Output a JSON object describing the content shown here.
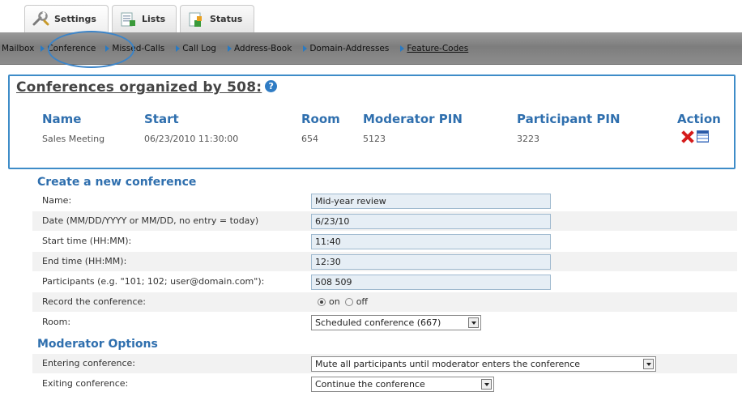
{
  "tabs": [
    {
      "label": "Settings",
      "icon": "wrench-icon"
    },
    {
      "label": "Lists",
      "icon": "list-icon"
    },
    {
      "label": "Status",
      "icon": "status-icon"
    }
  ],
  "subnav": [
    {
      "label": "Mailbox"
    },
    {
      "label": "Conference"
    },
    {
      "label": "Missed-Calls"
    },
    {
      "label": "Call Log"
    },
    {
      "label": "Address-Book"
    },
    {
      "label": "Domain-Addresses"
    },
    {
      "label": "Feature-Codes"
    }
  ],
  "conferences": {
    "title": "Conferences organized by 508:",
    "help_icon": "?",
    "headers": {
      "name": "Name",
      "start": "Start",
      "room": "Room",
      "moderator_pin": "Moderator PIN",
      "participant_pin": "Participant PIN",
      "action": "Action"
    },
    "rows": [
      {
        "name": "Sales Meeting",
        "start": "06/23/2010 11:30:00",
        "room": "654",
        "moderator_pin": "5123",
        "participant_pin": "3223"
      }
    ]
  },
  "create": {
    "heading": "Create a new conference",
    "name_label": "Name:",
    "name_value": "Mid-year review",
    "date_label": "Date (MM/DD/YYYY or MM/DD, no entry = today)",
    "date_value": "6/23/10",
    "start_label": "Start time (HH:MM):",
    "start_value": "11:40",
    "end_label": "End time (HH:MM):",
    "end_value": "12:30",
    "participants_label": "Participants (e.g. \"101; 102; user@domain.com\"):",
    "participants_value": "508 509",
    "record_label": "Record the conference:",
    "record_on": "on",
    "record_off": "off",
    "room_label": "Room:",
    "room_value": "Scheduled conference (667)"
  },
  "moderator": {
    "heading": "Moderator Options",
    "entering_label": "Entering conference:",
    "entering_value": "Mute all participants until moderator enters the conference",
    "exiting_label": "Exiting conference:",
    "exiting_value": "Continue the conference"
  }
}
